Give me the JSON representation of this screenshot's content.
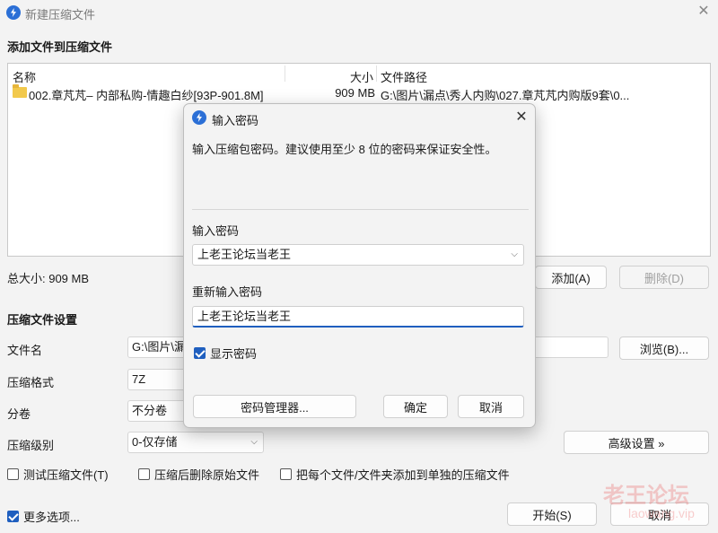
{
  "window": {
    "title": "新建压缩文件",
    "close": "✕"
  },
  "files_section": {
    "heading": "添加文件到压缩文件",
    "columns": {
      "name": "名称",
      "size": "大小",
      "path": "文件路径"
    },
    "rows": [
      {
        "name": "002.章芃芃– 内部私购-情趣白纱[93P-901.8M]",
        "size": "909 MB",
        "path": "G:\\图片\\漏点\\秀人内购\\027.章芃芃内购版9套\\0..."
      }
    ],
    "total": "总大小: 909 MB",
    "add_label": "添加(A)",
    "delete_label": "删除(D)"
  },
  "settings": {
    "heading": "压缩文件设置",
    "filename_label": "文件名",
    "filename_value": "G:\\图片\\漏",
    "browse_label": "浏览(B)...",
    "format_label": "压缩格式",
    "format_value": "7Z",
    "split_label": "分卷",
    "split_value": "不分卷",
    "level_label": "压缩级别",
    "level_value": "0-仅存储",
    "advanced_label": "高级设置 »",
    "test_label": "测试压缩文件(T)",
    "delete_after_label": "压缩后删除原始文件",
    "separate_label": "把每个文件/文件夹添加到单独的压缩文件",
    "more_label": "更多选项...",
    "start_label": "开始(S)",
    "cancel_label": "取消"
  },
  "dialog": {
    "title": "输入密码",
    "close": "✕",
    "description": "输入压缩包密码。建议使用至少 8 位的密码来保证安全性。",
    "password_label": "输入密码",
    "password_value": "上老王论坛当老王",
    "reenter_label": "重新输入密码",
    "reenter_value": "上老王论坛当老王",
    "show_password_label": "显示密码",
    "show_password_checked": true,
    "manager_label": "密码管理器...",
    "ok_label": "确定",
    "cancel_label": "取消"
  },
  "watermark": {
    "line1": "老王论坛",
    "line2": "laowang.vip"
  },
  "colors": {
    "accent": "#1f5fbf",
    "folder": "#f2c94c",
    "watermark": "#eb5050"
  },
  "icons": [
    "app-icon",
    "folder-icon",
    "close-icon",
    "chevron-down-icon",
    "checkbox-icon"
  ]
}
